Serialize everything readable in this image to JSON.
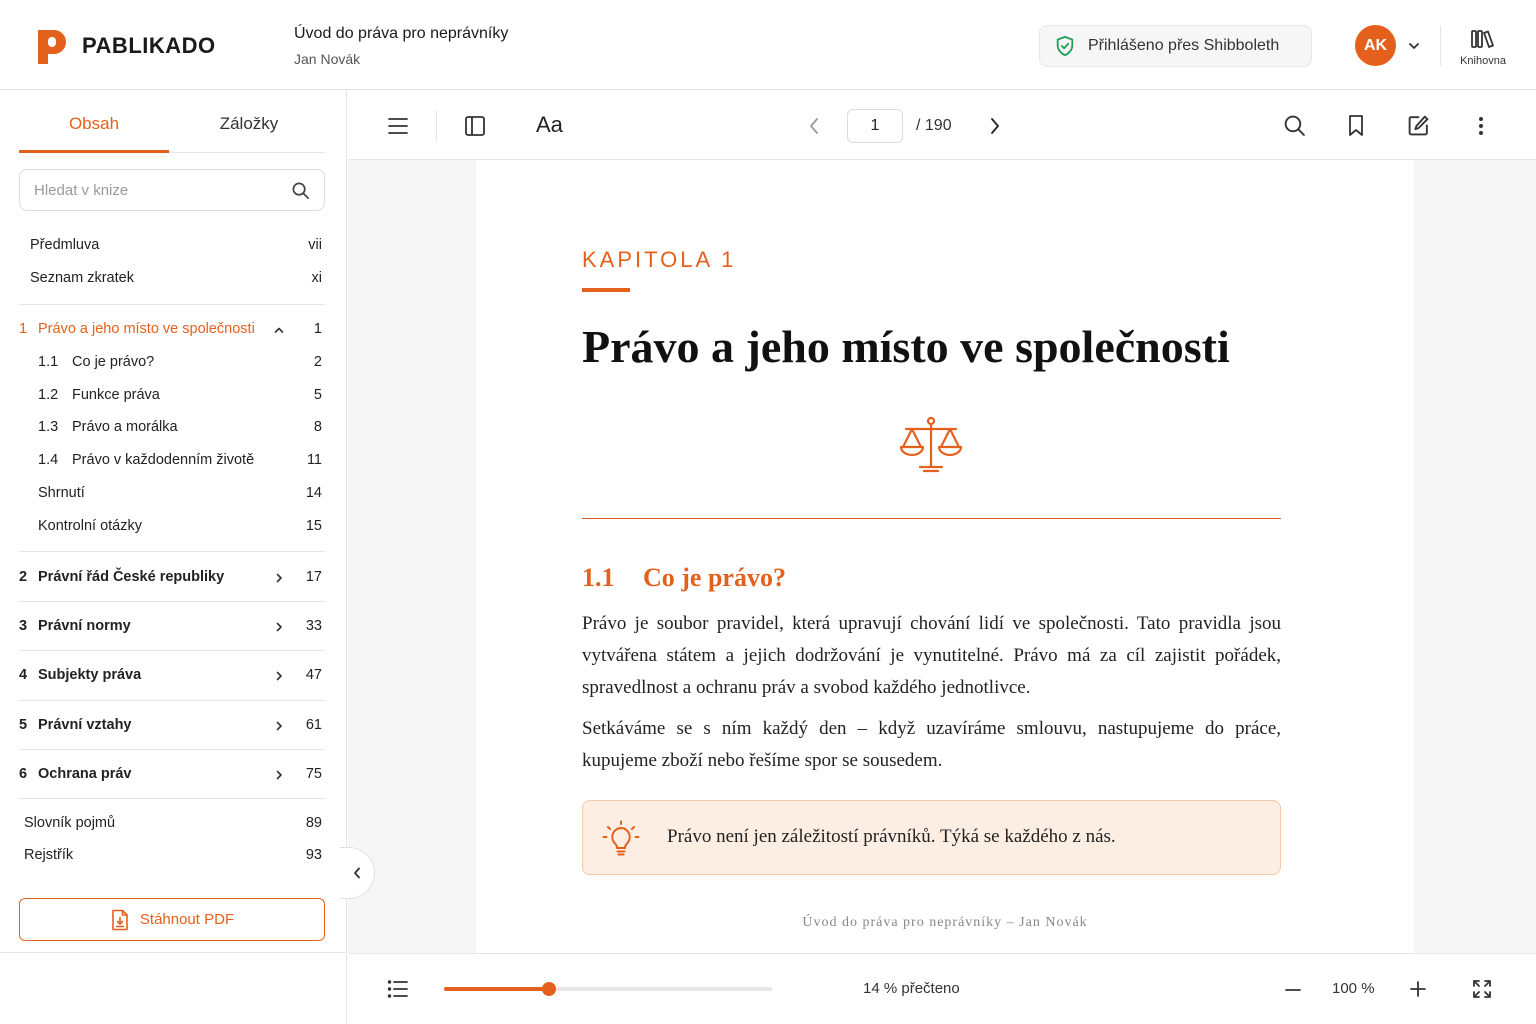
{
  "header": {
    "brand": "PABLIKADO",
    "book_title": "Úvod do práva pro neprávníky",
    "book_author": "Jan Novák",
    "auth_status": "Přihlášeno přes Shibboleth",
    "avatar_initials": "AK",
    "library_label": "Knihovna"
  },
  "sidebar": {
    "tabs": {
      "contents": "Obsah",
      "bookmarks": "Záložky"
    },
    "search_placeholder": "Hledat v knize",
    "front_items": [
      {
        "label": "Předmluva",
        "page": "vii"
      },
      {
        "label": "Seznam zkratek",
        "page": "xi"
      }
    ],
    "current_chapter": {
      "num": "1",
      "label": "Právo a jeho místo ve společnosti",
      "page": "1",
      "children": [
        {
          "num": "1.1",
          "label": "Co je právo?",
          "page": "2"
        },
        {
          "num": "1.2",
          "label": "Funkce práva",
          "page": "5"
        },
        {
          "num": "1.3",
          "label": "Právo a morálka",
          "page": "8"
        },
        {
          "num": "1.4",
          "label": "Právo v každodenním životě",
          "page": "11"
        },
        {
          "num": "",
          "label": "Shrnutí",
          "page": "14"
        },
        {
          "num": "",
          "label": "Kontrolní otázky",
          "page": "15"
        }
      ]
    },
    "chapters": [
      {
        "num": "2",
        "label": "Právní řád České republiky",
        "page": "17"
      },
      {
        "num": "3",
        "label": "Právní normy",
        "page": "33"
      },
      {
        "num": "4",
        "label": "Subjekty práva",
        "page": "47"
      },
      {
        "num": "5",
        "label": "Právní vztahy",
        "page": "61"
      },
      {
        "num": "6",
        "label": "Ochrana práv",
        "page": "75"
      }
    ],
    "back_items": [
      {
        "label": "Slovník pojmů",
        "page": "89"
      },
      {
        "label": "Rejstřík",
        "page": "93"
      }
    ],
    "download_label": "Stáhnout PDF"
  },
  "toolbar": {
    "font_label": "Aa",
    "current_page": "1",
    "total_pages": "/ 190"
  },
  "page": {
    "chapter_label": "KAPITOLA 1",
    "chapter_title": "Právo a jeho místo ve společnosti",
    "section_num": "1.1",
    "section_title": "Co je právo?",
    "paragraphs": [
      "Právo je soubor pravidel, která upravují chování lidí ve společnosti. Tato pravidla jsou vytvářena státem a jejich dodržování je vynutitelné. Právo má za cíl zajistit pořádek, spravedlnost a ochranu práv a svobod každého jednotlivce.",
      "Setkáváme se s ním každý den – když uzavíráme smlouvu, nastupujeme do práce, kupujeme zboží nebo řešíme spor se sousedem."
    ],
    "tip": "Právo není jen záležitostí právníků. Týká se každého z nás.",
    "footer": "Úvod do práva pro neprávníky – Jan Novák"
  },
  "bottom_bar": {
    "progress_fraction": 0.32,
    "progress_text": "14 % přečteno",
    "zoom": "100 %"
  },
  "colors": {
    "accent": "#e4611d",
    "tip_bg": "#fdeee3",
    "shield": "#22a05a"
  }
}
